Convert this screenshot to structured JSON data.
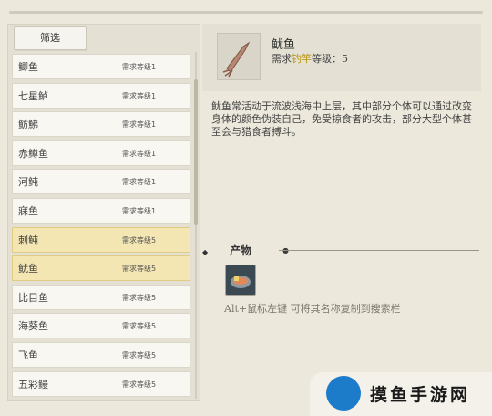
{
  "filter": {
    "label": "筛选"
  },
  "fish_list": [
    {
      "name": "鲫鱼",
      "req": "需求等级1"
    },
    {
      "name": "七星鲈",
      "req": "需求等级1"
    },
    {
      "name": "鲂鮄",
      "req": "需求等级1"
    },
    {
      "name": "赤鳟鱼",
      "req": "需求等级1"
    },
    {
      "name": "河鲀",
      "req": "需求等级1"
    },
    {
      "name": "寐鱼",
      "req": "需求等级1"
    },
    {
      "name": "刺鲀",
      "req": "需求等级5"
    },
    {
      "name": "鱿鱼",
      "req": "需求等级5"
    },
    {
      "name": "比目鱼",
      "req": "需求等级5"
    },
    {
      "name": "海葵鱼",
      "req": "需求等级5"
    },
    {
      "name": "飞鱼",
      "req": "需求等级5"
    },
    {
      "name": "五彩鳗",
      "req": "需求等级5"
    }
  ],
  "detail": {
    "title": "鱿鱼",
    "req_prefix": "需求",
    "tool": "钓竿",
    "level_label": "等级：",
    "level_value": "5",
    "description": "鱿鱼常活动于流波浅海中上层，其中部分个体可以通过改变身体的颜色伪装自己，免受掠食者的攻击，部分大型个体甚至会与猎食者搏斗。"
  },
  "products": {
    "header": "产物",
    "hint": "Alt+鼠标左键 可将其名称复制到搜索栏"
  },
  "watermark": {
    "text": "摸鱼手游网"
  },
  "colors": {
    "highlight": "#f4e6b2",
    "tool": "#b8950e",
    "watermark_logo": "#1c7cc9"
  }
}
